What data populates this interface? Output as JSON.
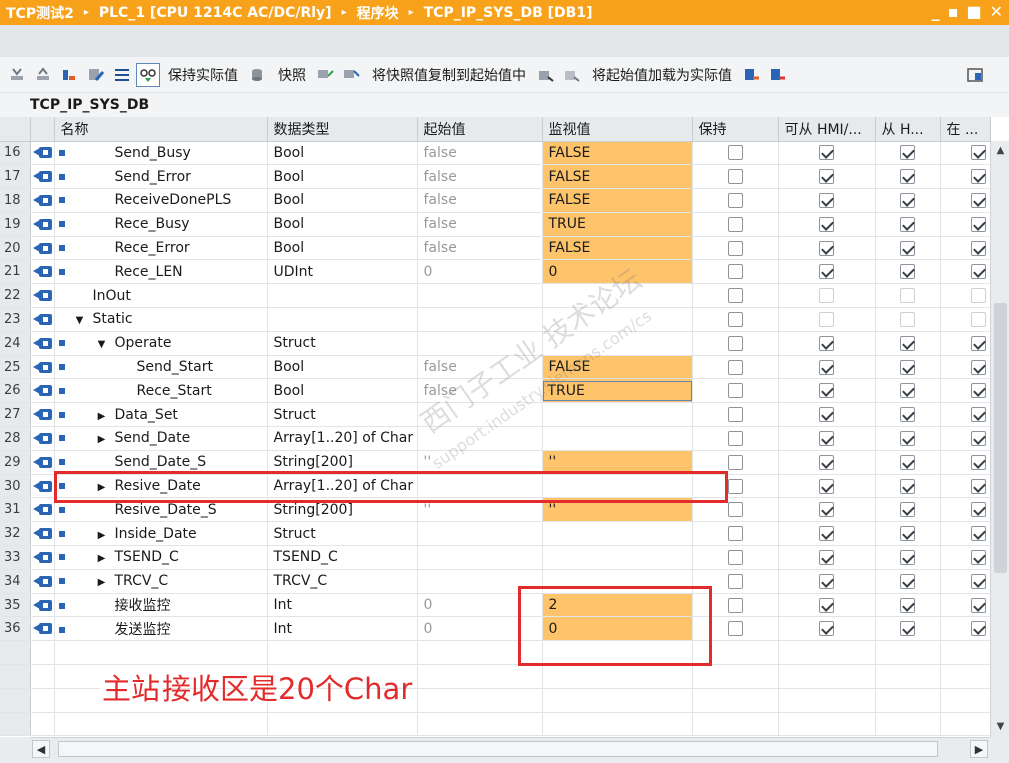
{
  "titlebar": {
    "crumbs": [
      "TCP测试2",
      "PLC_1 [CPU 1214C AC/DC/Rly]",
      "程序块",
      "TCP_IP_SYS_DB [DB1]"
    ],
    "separator": "▸",
    "controls": [
      "_",
      "▪",
      "■",
      "✕"
    ]
  },
  "toolbar": {
    "keep_actual": "保持实际值",
    "snapshot": "快照",
    "copy_snapshot": "将快照值复制到起始值中",
    "load_start": "将起始值加载为实际值"
  },
  "db_name": "TCP_IP_SYS_DB",
  "columns": [
    "名称",
    "数据类型",
    "起始值",
    "监视值",
    "保持",
    "可从 HMI/...",
    "从 H...",
    "在 ..."
  ],
  "rows": [
    {
      "num": "16",
      "level": 1,
      "tri": "",
      "bullet": true,
      "name": "Send_Busy",
      "type": "Bool",
      "start": "false",
      "monitor": "FALSE",
      "mon_hl": true,
      "hmi": "on",
      "fromh": "on"
    },
    {
      "num": "17",
      "level": 1,
      "tri": "",
      "bullet": true,
      "name": "Send_Error",
      "type": "Bool",
      "start": "false",
      "monitor": "FALSE",
      "mon_hl": true,
      "hmi": "on",
      "fromh": "on"
    },
    {
      "num": "18",
      "level": 1,
      "tri": "",
      "bullet": true,
      "name": "ReceiveDonePLS",
      "type": "Bool",
      "start": "false",
      "monitor": "FALSE",
      "mon_hl": true,
      "hmi": "on",
      "fromh": "on"
    },
    {
      "num": "19",
      "level": 1,
      "tri": "",
      "bullet": true,
      "name": "Rece_Busy",
      "type": "Bool",
      "start": "false",
      "monitor": "TRUE",
      "mon_hl": true,
      "hmi": "on",
      "fromh": "on"
    },
    {
      "num": "20",
      "level": 1,
      "tri": "",
      "bullet": true,
      "name": "Rece_Error",
      "type": "Bool",
      "start": "false",
      "monitor": "FALSE",
      "mon_hl": true,
      "hmi": "on",
      "fromh": "on"
    },
    {
      "num": "21",
      "level": 1,
      "tri": "",
      "bullet": true,
      "name": "Rece_LEN",
      "type": "UDInt",
      "start": "0",
      "monitor": "0",
      "mon_hl": true,
      "hmi": "on",
      "fromh": "on"
    },
    {
      "num": "22",
      "level": 0,
      "tri": "",
      "bullet": false,
      "name": "InOut",
      "type": "",
      "start": "",
      "monitor": "",
      "mon_hl": false,
      "hmi": "dim",
      "fromh": "dim"
    },
    {
      "num": "23",
      "level": 0,
      "tri": "▼",
      "bullet": false,
      "name": "Static",
      "type": "",
      "start": "",
      "monitor": "",
      "mon_hl": false,
      "hmi": "dim",
      "fromh": "dim"
    },
    {
      "num": "24",
      "level": 1,
      "tri": "▼",
      "bullet": true,
      "name": "Operate",
      "type": "Struct",
      "start": "",
      "monitor": "",
      "mon_hl": false,
      "hmi": "on",
      "fromh": "on"
    },
    {
      "num": "25",
      "level": 2,
      "tri": "",
      "bullet": true,
      "name": "Send_Start",
      "type": "Bool",
      "start": "false",
      "monitor": "FALSE",
      "mon_hl": true,
      "hmi": "on",
      "fromh": "on"
    },
    {
      "num": "26",
      "level": 2,
      "tri": "",
      "bullet": true,
      "name": "Rece_Start",
      "type": "Bool",
      "start": "false",
      "monitor": "TRUE",
      "mon_hl": true,
      "sel": true,
      "hmi": "on",
      "fromh": "on"
    },
    {
      "num": "27",
      "level": 1,
      "tri": "▶",
      "bullet": true,
      "name": "Data_Set",
      "type": "Struct",
      "start": "",
      "monitor": "",
      "mon_hl": false,
      "hmi": "on",
      "fromh": "on"
    },
    {
      "num": "28",
      "level": 1,
      "tri": "▶",
      "bullet": true,
      "name": "Send_Date",
      "type": "Array[1..20] of Char",
      "start": "",
      "monitor": "",
      "mon_hl": false,
      "hmi": "on",
      "fromh": "on"
    },
    {
      "num": "29",
      "level": 1,
      "tri": "",
      "bullet": true,
      "name": "Send_Date_S",
      "type": "String[200]",
      "start": "''",
      "monitor": "''",
      "mon_hl": true,
      "hmi": "on",
      "fromh": "on"
    },
    {
      "num": "30",
      "level": 1,
      "tri": "▶",
      "bullet": true,
      "name": "Resive_Date",
      "type": "Array[1..20] of Char",
      "start": "",
      "monitor": "",
      "mon_hl": false,
      "hmi": "on",
      "fromh": "on"
    },
    {
      "num": "31",
      "level": 1,
      "tri": "",
      "bullet": true,
      "name": "Resive_Date_S",
      "type": "String[200]",
      "start": "''",
      "monitor": "''",
      "mon_hl": true,
      "hmi": "on",
      "fromh": "on"
    },
    {
      "num": "32",
      "level": 1,
      "tri": "▶",
      "bullet": true,
      "name": "Inside_Date",
      "type": "Struct",
      "start": "",
      "monitor": "",
      "mon_hl": false,
      "hmi": "on",
      "fromh": "on"
    },
    {
      "num": "33",
      "level": 1,
      "tri": "▶",
      "bullet": true,
      "name": "TSEND_C",
      "type": "TSEND_C",
      "start": "",
      "monitor": "",
      "mon_hl": false,
      "hmi": "on",
      "fromh": "on"
    },
    {
      "num": "34",
      "level": 1,
      "tri": "▶",
      "bullet": true,
      "name": "TRCV_C",
      "type": "TRCV_C",
      "start": "",
      "monitor": "",
      "mon_hl": false,
      "hmi": "on",
      "fromh": "on"
    },
    {
      "num": "35",
      "level": 1,
      "tri": "",
      "bullet": true,
      "name": "接收监控",
      "type": "Int",
      "start": "0",
      "monitor": "2",
      "mon_hl": true,
      "hmi": "on",
      "fromh": "on"
    },
    {
      "num": "36",
      "level": 1,
      "tri": "",
      "bullet": true,
      "name": "发送监控",
      "type": "Int",
      "start": "0",
      "monitor": "0",
      "mon_hl": true,
      "hmi": "on",
      "fromh": "on"
    }
  ],
  "annotation": {
    "highlight_part": "主站",
    "rest_part": "接收区是20个Char"
  },
  "watermark": {
    "line1": "西门子工业 技术论坛",
    "line2": "support.industry.siemens.com/cs"
  },
  "colors": {
    "title_bar": "#f7a21a",
    "monitor_highlight": "#fdc46b",
    "annotation_red": "#e32b2b",
    "interface_icon": "#2a64b4"
  }
}
